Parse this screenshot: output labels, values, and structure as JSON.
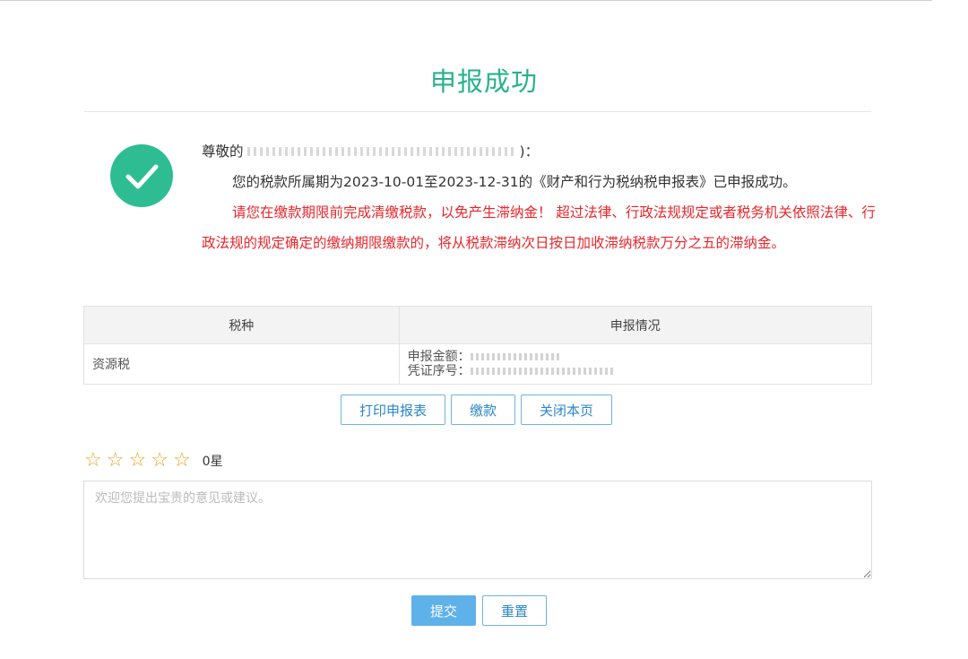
{
  "title": "申报成功",
  "message": {
    "greeting_prefix": "尊敬的",
    "greeting_suffix": ")：",
    "line1": "您的税款所属期为2023-10-01至2023-12-31的《财产和行为税纳税申报表》已申报成功。",
    "warning": "请您在缴款期限前完成清缴税款，以免产生滞纳金！ 超过法律、行政法规规定或者税务机关依照法律、行政法规的规定确定的缴纳期限缴款的，将从税款滞纳次日按日加收滞纳税款万分之五的滞纳金。"
  },
  "table": {
    "headers": [
      "税种",
      "申报情况"
    ],
    "rows": [
      {
        "tax_type": "资源税",
        "amount_label": "申报金额：",
        "voucher_label": "凭证序号："
      }
    ]
  },
  "buttons": {
    "print": "打印申报表",
    "pay": "缴款",
    "close": "关闭本页"
  },
  "rating": {
    "count_label": "0星",
    "stars": 5,
    "selected": 0
  },
  "feedback": {
    "placeholder": "欢迎您提出宝贵的意见或建议。",
    "value": ""
  },
  "form_buttons": {
    "submit": "提交",
    "reset": "重置"
  },
  "colors": {
    "accent_green": "#28b28b",
    "warning_red": "#e8262b",
    "button_blue": "#5fb1ea",
    "star": "#f0a020"
  }
}
